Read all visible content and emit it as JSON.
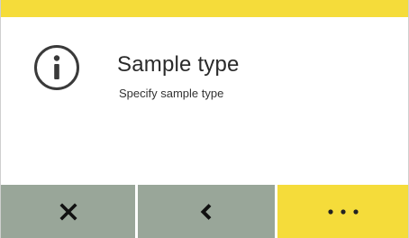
{
  "dialog": {
    "title": "Sample type",
    "subtitle": "Specify sample type",
    "icon": "info-icon"
  },
  "footer": {
    "buttons": [
      {
        "name": "close",
        "icon": "close-icon"
      },
      {
        "name": "back",
        "icon": "chevron-left-icon"
      },
      {
        "name": "more",
        "icon": "more-dots-icon"
      }
    ]
  },
  "colors": {
    "accent": "#f5dc3a",
    "button_gray": "#99a699",
    "text": "#2a2a2a"
  }
}
